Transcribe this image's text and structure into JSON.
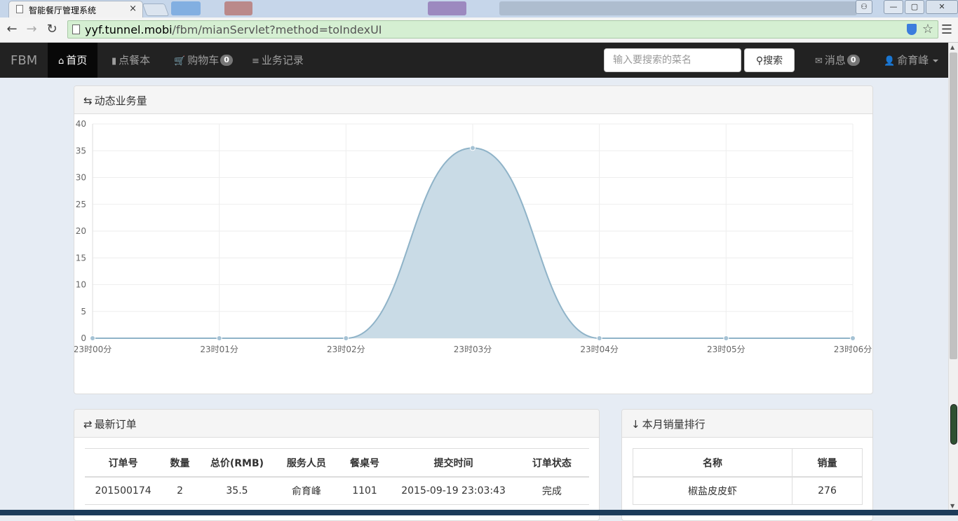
{
  "browser": {
    "tab_title": "智能餐厅管理系统",
    "tab_close": "×",
    "url_host": "yyf.tunnel.mobi",
    "url_path": "/fbm/mianServlet?method=toIndexUI",
    "back": "←",
    "forward": "→",
    "reload": "↻",
    "star": "☆",
    "menu": "☰",
    "win_user": "⚇",
    "win_min": "—",
    "win_max": "▢",
    "win_close": "✕"
  },
  "navbar": {
    "brand": "FBM",
    "items": [
      {
        "icon": "⌂",
        "label": "首页",
        "badge": ""
      },
      {
        "icon": "▮",
        "label": "点餐本",
        "badge": ""
      },
      {
        "icon": "🛒",
        "label": "购物车",
        "badge": "0"
      },
      {
        "icon": "≡",
        "label": "业务记录",
        "badge": ""
      }
    ],
    "search_placeholder": "输入要搜索的菜名",
    "search_button": "搜索",
    "search_icon": "⚲",
    "messages_icon": "✉",
    "messages_label": "消息",
    "messages_badge": "0",
    "user_icon": "👤",
    "user_name": "俞育峰"
  },
  "chart_panel": {
    "icon": "⇆",
    "title": "动态业务量"
  },
  "chart_data": {
    "type": "area",
    "x": [
      "23时00分",
      "23时01分",
      "23时02分",
      "23时03分",
      "23时04分",
      "23时05分",
      "23时06分"
    ],
    "values": [
      0,
      0,
      0,
      35.5,
      0,
      0,
      0
    ],
    "ylim": [
      0,
      40
    ],
    "yticks": [
      0,
      5,
      10,
      15,
      20,
      25,
      30,
      35,
      40
    ],
    "grid": true,
    "fill_color": "#c9dbe6",
    "line_color": "#8fb3c8",
    "point_color": "#a5c2d4"
  },
  "orders_panel": {
    "icon": "⇄",
    "title": "最新订单",
    "columns": [
      "订单号",
      "数量",
      "总价(RMB)",
      "服务人员",
      "餐桌号",
      "提交时间",
      "订单状态"
    ],
    "rows": [
      [
        "201500174",
        "2",
        "35.5",
        "俞育峰",
        "1101",
        "2015-09-19 23:03:43",
        "完成"
      ]
    ]
  },
  "rank_panel": {
    "icon": "↓",
    "title": "本月销量排行",
    "columns": [
      "名称",
      "销量"
    ],
    "rows": [
      [
        "椒盐皮皮虾",
        "276"
      ]
    ]
  }
}
